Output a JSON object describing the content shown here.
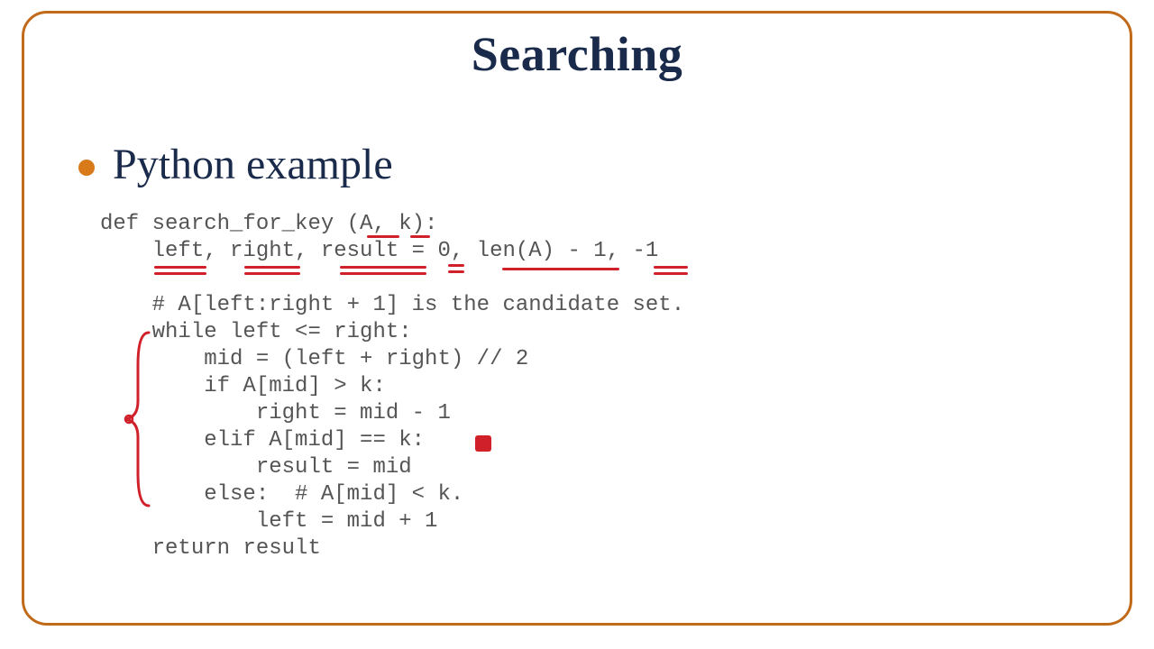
{
  "title": "Searching",
  "bullet": "Python example",
  "code_lines": [
    "def search_for_key (A, k):",
    "    left, right, result = 0, len(A) - 1, -1",
    "",
    "    # A[left:right + 1] is the candidate set.",
    "    while left <= right:",
    "        mid = (left + right) // 2",
    "        if A[mid] > k:",
    "            right = mid - 1",
    "        elif A[mid] == k:",
    "            result = mid",
    "        else:  # A[mid] < k.",
    "            left = mid + 1",
    "    return result"
  ]
}
